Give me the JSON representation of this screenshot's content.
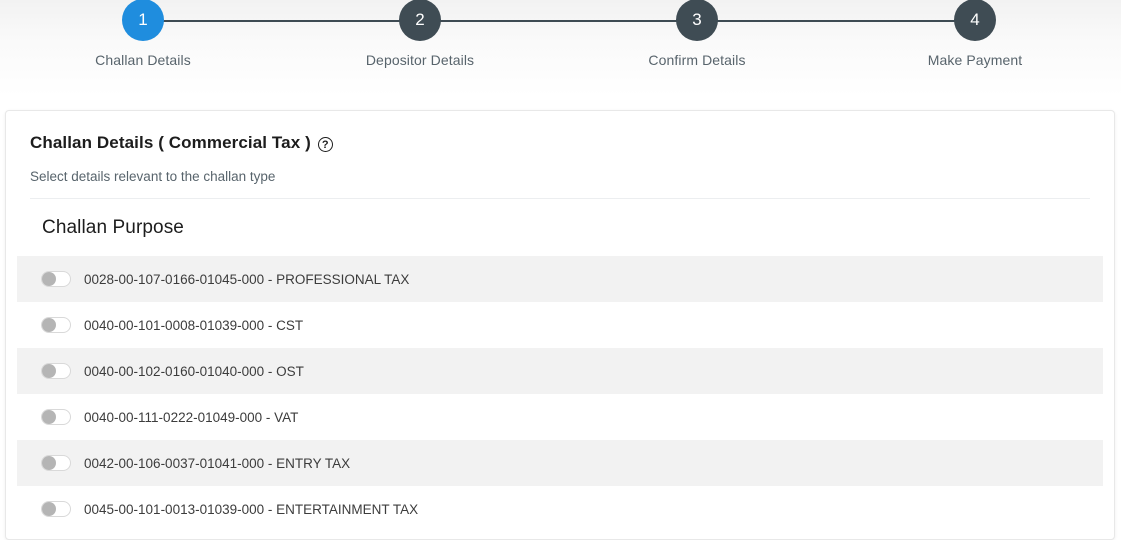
{
  "stepper": {
    "steps": [
      {
        "number": "1",
        "label": "Challan Details",
        "state": "active"
      },
      {
        "number": "2",
        "label": "Depositor Details",
        "state": "inactive"
      },
      {
        "number": "3",
        "label": "Confirm Details",
        "state": "inactive"
      },
      {
        "number": "4",
        "label": "Make Payment",
        "state": "inactive"
      }
    ],
    "active_color": "#1f8dde",
    "inactive_color": "#3f4c54"
  },
  "card": {
    "title": "Challan Details ( Commercial Tax )",
    "help_icon": "help-circle-icon",
    "subtitle": "Select details relevant to the challan type",
    "section_title": "Challan Purpose",
    "purposes": [
      {
        "code": "0028-00-107-0166-01045-000",
        "name": "PROFESSIONAL TAX",
        "label": "0028-00-107-0166-01045-000 - PROFESSIONAL TAX",
        "toggle": "off"
      },
      {
        "code": "0040-00-101-0008-01039-000",
        "name": "CST",
        "label": "0040-00-101-0008-01039-000 - CST",
        "toggle": "off"
      },
      {
        "code": "0040-00-102-0160-01040-000",
        "name": "OST",
        "label": "0040-00-102-0160-01040-000 - OST",
        "toggle": "off"
      },
      {
        "code": "0040-00-111-0222-01049-000",
        "name": "VAT",
        "label": "0040-00-111-0222-01049-000 - VAT",
        "toggle": "off"
      },
      {
        "code": "0042-00-106-0037-01041-000",
        "name": "ENTRY TAX",
        "label": "0042-00-106-0037-01041-000 - ENTRY TAX",
        "toggle": "off"
      },
      {
        "code": "0045-00-101-0013-01039-000",
        "name": "ENTERTAINMENT TAX",
        "label": "0045-00-101-0013-01039-000 - ENTERTAINMENT TAX",
        "toggle": "off"
      }
    ]
  }
}
